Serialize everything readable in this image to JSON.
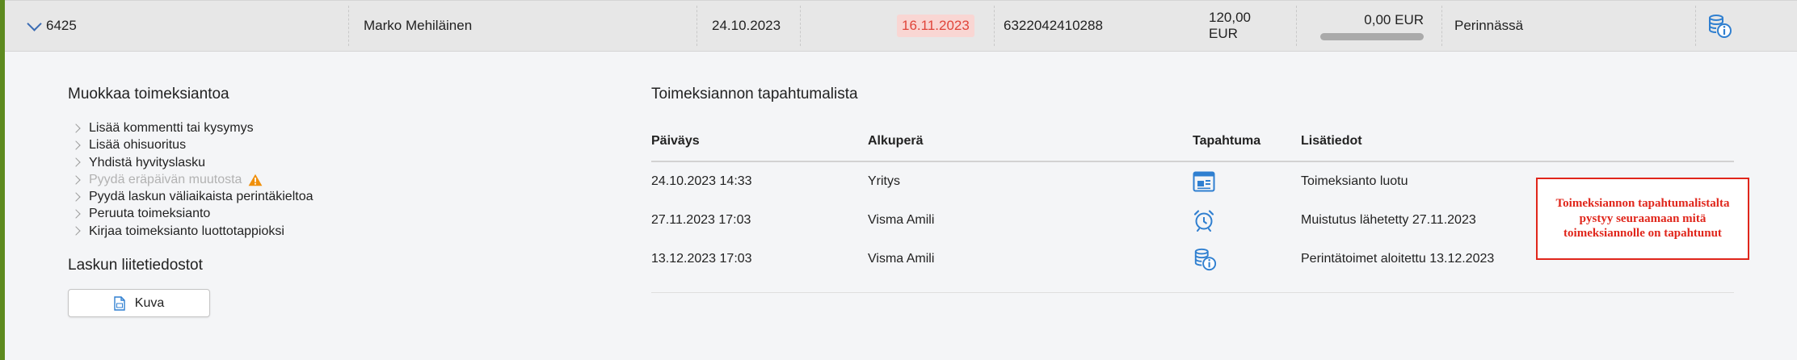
{
  "summary": {
    "invoice_number": "6425",
    "customer": "Marko Mehiläinen",
    "invoice_date": "24.10.2023",
    "due_date": "16.11.2023",
    "reference": "6322042410288",
    "amount": "120,00 EUR",
    "paid_amount": "0,00 EUR",
    "paid_progress": 0,
    "status": "Perinnässä",
    "status_icon": "collection-coins-info-icon",
    "due_color": "#e0453a"
  },
  "edit": {
    "title": "Muokkaa toimeksiantoa",
    "actions": [
      {
        "label": "Lisää kommentti tai kysymys",
        "enabled": true
      },
      {
        "label": "Lisää ohisuoritus",
        "enabled": true
      },
      {
        "label": "Yhdistä hyvityslasku",
        "enabled": true
      },
      {
        "label": "Pyydä eräpäivän muutosta",
        "enabled": false,
        "warning": true
      },
      {
        "label": "Pyydä laskun väliaikaista perintäkieltoa",
        "enabled": true
      },
      {
        "label": "Peruuta toimeksianto",
        "enabled": true
      },
      {
        "label": "Kirjaa toimeksianto luottotappioksi",
        "enabled": true
      }
    ]
  },
  "attachments": {
    "title": "Laskun liitetiedostot",
    "file_label": "Kuva"
  },
  "history": {
    "title": "Toimeksiannon tapahtumalista",
    "headers": [
      "Päiväys",
      "Alkuperä",
      "Tapahtuma",
      "Lisätiedot"
    ],
    "rows": [
      {
        "date": "24.10.2023 14:33",
        "origin": "Yritys",
        "event_icon": "document-chart-icon",
        "details": "Toimeksianto luotu"
      },
      {
        "date": "27.11.2023 17:03",
        "origin": "Visma Amili",
        "event_icon": "alarm-clock-icon",
        "details": "Muistutus lähetetty 27.11.2023"
      },
      {
        "date": "13.12.2023 17:03",
        "origin": "Visma Amili",
        "event_icon": "coins-info-icon",
        "details": "Perintätoimet aloitettu 13.12.2023"
      }
    ]
  },
  "annotation": {
    "text": "Toimeksiannon tapahtumalistalta pystyy seuraamaan mitä toimeksiannolle on tapahtunut"
  },
  "colors": {
    "accent_green": "#5d8a1f",
    "icon_blue": "#2f7fd0",
    "warning_orange": "#f0900c",
    "annotation_red": "#e0261b"
  }
}
